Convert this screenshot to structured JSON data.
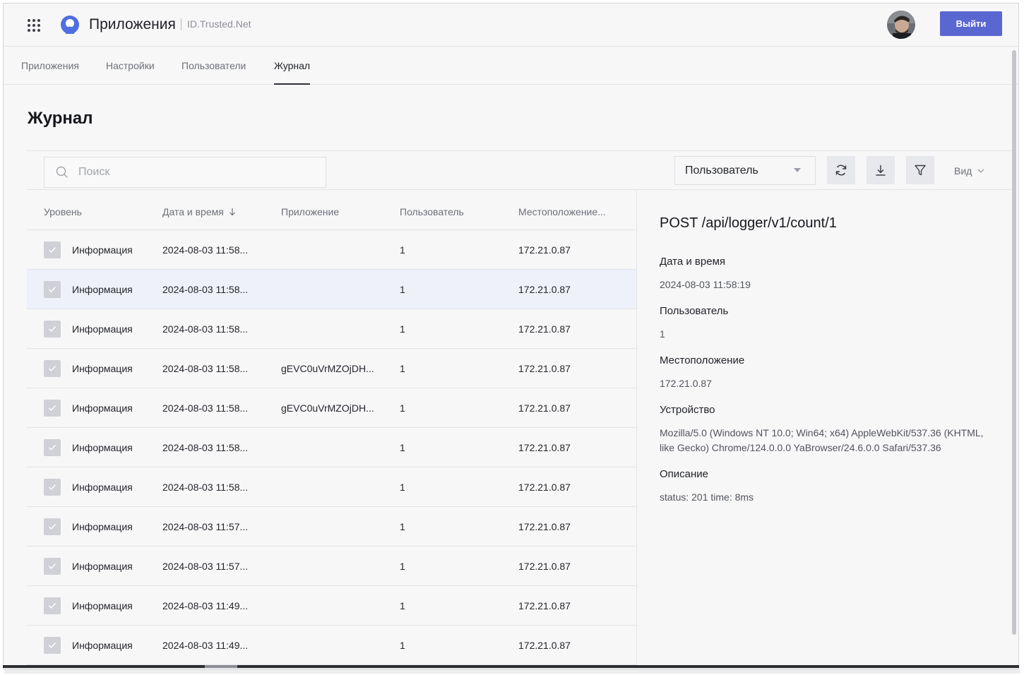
{
  "header": {
    "app_title": "Приложения",
    "subtitle": "ID.Trusted.Net",
    "logout_label": "Выйти"
  },
  "tabs": [
    {
      "label": "Приложения",
      "active": false
    },
    {
      "label": "Настройки",
      "active": false
    },
    {
      "label": "Пользователи",
      "active": false
    },
    {
      "label": "Журнал",
      "active": true
    }
  ],
  "page": {
    "title": "Журнал"
  },
  "toolbar": {
    "search_placeholder": "Поиск",
    "search_value": "",
    "filter_select_value": "Пользователь",
    "refresh_icon": "refresh-icon",
    "download_icon": "download-icon",
    "filter_icon": "filter-icon",
    "view_label": "Вид"
  },
  "table": {
    "columns": [
      "Уровень",
      "Дата и время",
      "Приложение",
      "Пользователь",
      "Местоположение..."
    ],
    "sort_icon": "arrow-down-icon",
    "rows": [
      {
        "level": "Информация",
        "datetime": "2024-08-03 11:58...",
        "app": "",
        "user": "1",
        "location": "172.21.0.87",
        "selected": false
      },
      {
        "level": "Информация",
        "datetime": "2024-08-03 11:58...",
        "app": "",
        "user": "1",
        "location": "172.21.0.87",
        "selected": true
      },
      {
        "level": "Информация",
        "datetime": "2024-08-03 11:58...",
        "app": "",
        "user": "1",
        "location": "172.21.0.87",
        "selected": false
      },
      {
        "level": "Информация",
        "datetime": "2024-08-03 11:58...",
        "app": "gEVC0uVrMZOjDH...",
        "user": "1",
        "location": "172.21.0.87",
        "selected": false
      },
      {
        "level": "Информация",
        "datetime": "2024-08-03 11:58...",
        "app": "gEVC0uVrMZOjDH...",
        "user": "1",
        "location": "172.21.0.87",
        "selected": false
      },
      {
        "level": "Информация",
        "datetime": "2024-08-03 11:58...",
        "app": "",
        "user": "1",
        "location": "172.21.0.87",
        "selected": false
      },
      {
        "level": "Информация",
        "datetime": "2024-08-03 11:58...",
        "app": "",
        "user": "1",
        "location": "172.21.0.87",
        "selected": false
      },
      {
        "level": "Информация",
        "datetime": "2024-08-03 11:57...",
        "app": "",
        "user": "1",
        "location": "172.21.0.87",
        "selected": false
      },
      {
        "level": "Информация",
        "datetime": "2024-08-03 11:57...",
        "app": "",
        "user": "1",
        "location": "172.21.0.87",
        "selected": false
      },
      {
        "level": "Информация",
        "datetime": "2024-08-03 11:49...",
        "app": "",
        "user": "1",
        "location": "172.21.0.87",
        "selected": false
      },
      {
        "level": "Информация",
        "datetime": "2024-08-03 11:49...",
        "app": "",
        "user": "1",
        "location": "172.21.0.87",
        "selected": false
      }
    ]
  },
  "detail": {
    "title": "POST /api/logger/v1/count/1",
    "datetime_label": "Дата и время",
    "datetime_value": "2024-08-03 11:58:19",
    "user_label": "Пользователь",
    "user_value": "1",
    "location_label": "Местоположение",
    "location_value": "172.21.0.87",
    "device_label": "Устройство",
    "device_value": "Mozilla/5.0 (Windows NT 10.0; Win64; x64) AppleWebKit/537.36 (KHTML, like Gecko) Chrome/124.0.0.0 YaBrowser/24.6.0.0 Safari/537.36",
    "description_label": "Описание",
    "description_value": "status: 201 time: 8ms"
  },
  "colors": {
    "accent": "#5a67d1",
    "selected_row": "#eef0fa",
    "background": "#f7f7f8"
  }
}
